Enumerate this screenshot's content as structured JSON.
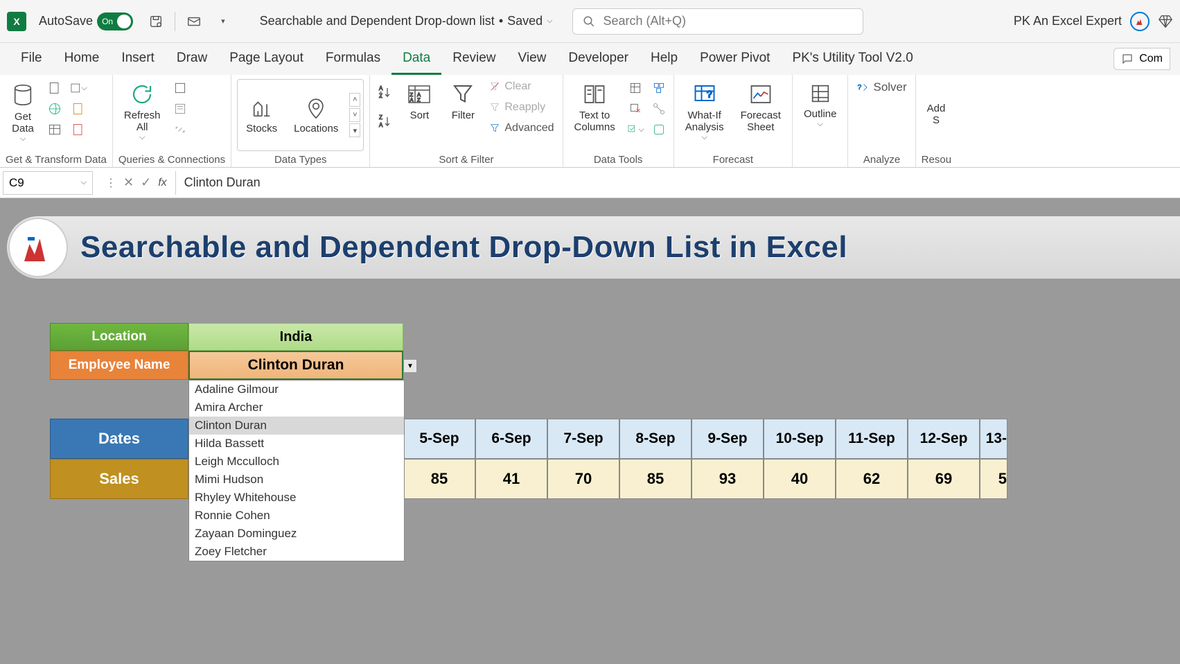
{
  "titlebar": {
    "autosave_label": "AutoSave",
    "autosave_state": "On",
    "filename": "Searchable and Dependent Drop-down list",
    "save_state": "Saved",
    "search_placeholder": "Search (Alt+Q)",
    "username": "PK An Excel Expert"
  },
  "tabs": {
    "items": [
      "File",
      "Home",
      "Insert",
      "Draw",
      "Page Layout",
      "Formulas",
      "Data",
      "Review",
      "View",
      "Developer",
      "Help",
      "Power Pivot",
      "PK's Utility Tool V2.0"
    ],
    "active": "Data",
    "comments": "Com"
  },
  "ribbon": {
    "get_data": "Get\nData",
    "group1": "Get & Transform Data",
    "refresh": "Refresh\nAll",
    "group2": "Queries & Connections",
    "stocks": "Stocks",
    "locations": "Locations",
    "group3": "Data Types",
    "sort": "Sort",
    "filter": "Filter",
    "clear": "Clear",
    "reapply": "Reapply",
    "advanced": "Advanced",
    "group4": "Sort & Filter",
    "text_cols": "Text to\nColumns",
    "group5": "Data Tools",
    "whatif": "What-If\nAnalysis",
    "forecast": "Forecast\nSheet",
    "group6": "Forecast",
    "outline": "Outline",
    "solver": "Solver",
    "group7": "Analyze",
    "add": "Add",
    "group8": "Resou"
  },
  "formula_bar": {
    "cell_ref": "C9",
    "value": "Clinton Duran"
  },
  "banner": {
    "title": "Searchable and Dependent Drop-Down List in Excel"
  },
  "mini": {
    "location_hdr": "Location",
    "location_val": "India",
    "emp_hdr": "Employee Name",
    "emp_val": "Clinton Duran"
  },
  "dropdown": {
    "items": [
      "Adaline Gilmour",
      "Amira Archer",
      "Clinton Duran",
      "Hilda Bassett",
      "Leigh Mcculloch",
      "Mimi Hudson",
      "Rhyley Whitehouse",
      "Ronnie Cohen",
      "Zayaan Dominguez",
      "Zoey Fletcher"
    ],
    "selected": "Clinton Duran"
  },
  "datatable": {
    "dates_hdr": "Dates",
    "sales_hdr": "Sales",
    "dates": [
      "5-Sep",
      "6-Sep",
      "7-Sep",
      "8-Sep",
      "9-Sep",
      "10-Sep",
      "11-Sep",
      "12-Sep",
      "13-"
    ],
    "sales": [
      "85",
      "41",
      "70",
      "85",
      "93",
      "40",
      "62",
      "69",
      "5"
    ]
  }
}
